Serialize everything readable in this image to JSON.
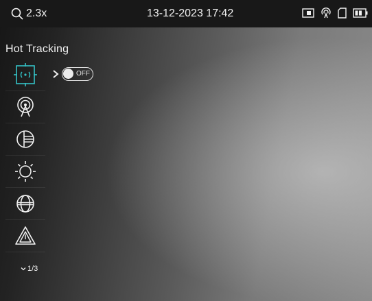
{
  "topbar": {
    "zoom_level": "2.3x",
    "zoom_icon": "magnifier-icon",
    "datetime": "13-12-2023 17:42",
    "status_icons": [
      "picture-in-picture-icon",
      "wifi-hotspot-icon",
      "sd-card-icon",
      "battery-icon"
    ]
  },
  "menu": {
    "title": "Hot Tracking",
    "items": [
      {
        "icon": "hot-tracking-icon",
        "active": true
      },
      {
        "icon": "wifi-hotspot-icon",
        "active": false
      },
      {
        "icon": "image-mode-icon",
        "active": false
      },
      {
        "icon": "brightness-icon",
        "active": false
      },
      {
        "icon": "contrast-icon",
        "active": false
      },
      {
        "icon": "warning-icon",
        "active": false
      }
    ],
    "toggle_label": "OFF",
    "page_indicator": "1/3"
  },
  "colors": {
    "accent": "#34c1c5",
    "icon": "#f2f2f2"
  }
}
